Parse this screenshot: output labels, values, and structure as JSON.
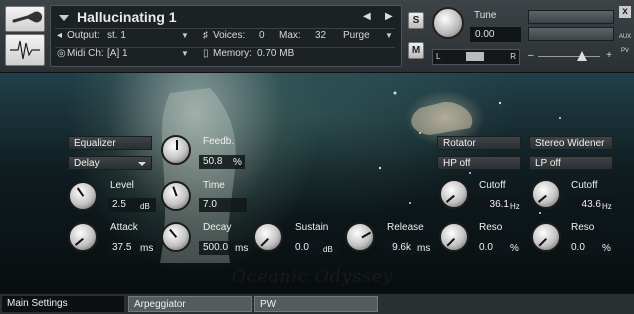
{
  "header": {
    "instrument_name": "Hallucinating 1",
    "output_label": "Output:",
    "output_value": "st. 1",
    "voices_label": "Voices:",
    "voices_value": "0",
    "max_label": "Max:",
    "max_value": "32",
    "purge_label": "Purge",
    "midi_label": "Midi Ch:",
    "midi_value": "[A]  1",
    "memory_label": "Memory:",
    "memory_value": "0.70 MB",
    "solo_label": "S",
    "mute_label": "M",
    "tune_label": "Tune",
    "tune_value": "0.00",
    "pan_left": "L",
    "pan_right": "R",
    "aux_label": "AUX",
    "pv_label": "PV",
    "close_label": "x"
  },
  "artwork": {
    "title": "Oceanic Odyssey"
  },
  "left_controls": {
    "equalizer_label": "Equalizer",
    "delay_label": "Delay",
    "feedback_label": "Feedb.",
    "feedback_value": "50.8",
    "feedback_unit": "%",
    "level_label": "Level",
    "level_value": "2.5",
    "level_unit": "dB",
    "time_label": "Time",
    "time_value": "7.0",
    "attack_label": "Attack",
    "attack_value": "37.5",
    "attack_unit": "ms",
    "decay_label": "Decay",
    "decay_value": "500.0",
    "decay_unit": "ms",
    "sustain_label": "Sustain",
    "sustain_value": "0.0",
    "sustain_unit": "dB",
    "release_label": "Release",
    "release_value": "9.6k",
    "release_unit": "ms"
  },
  "right_controls": {
    "rotator_label": "Rotator",
    "stereo_widener_label": "Stereo Widener",
    "hp_label": "HP off",
    "lp_label": "LP off",
    "hp_cutoff_label": "Cutoff",
    "hp_cutoff_value": "36.1",
    "hp_cutoff_unit": "Hz",
    "lp_cutoff_label": "Cutoff",
    "lp_cutoff_value": "43.6",
    "lp_cutoff_unit": "Hz",
    "hp_reso_label": "Reso",
    "hp_reso_value": "0.0",
    "hp_reso_unit": "%",
    "lp_reso_label": "Reso",
    "lp_reso_value": "0.0",
    "lp_reso_unit": "%"
  },
  "tabs": [
    "Main Settings",
    "Arpeggiator",
    "PW"
  ],
  "colors": {
    "panel": "#2a3033",
    "value_box": "#111517",
    "button": "#3e4447",
    "text": "#f0f0f0"
  },
  "icons": [
    "wrench-icon",
    "waveform-icon",
    "output-speaker-icon",
    "voices-icon",
    "midi-icon",
    "memory-icon"
  ]
}
